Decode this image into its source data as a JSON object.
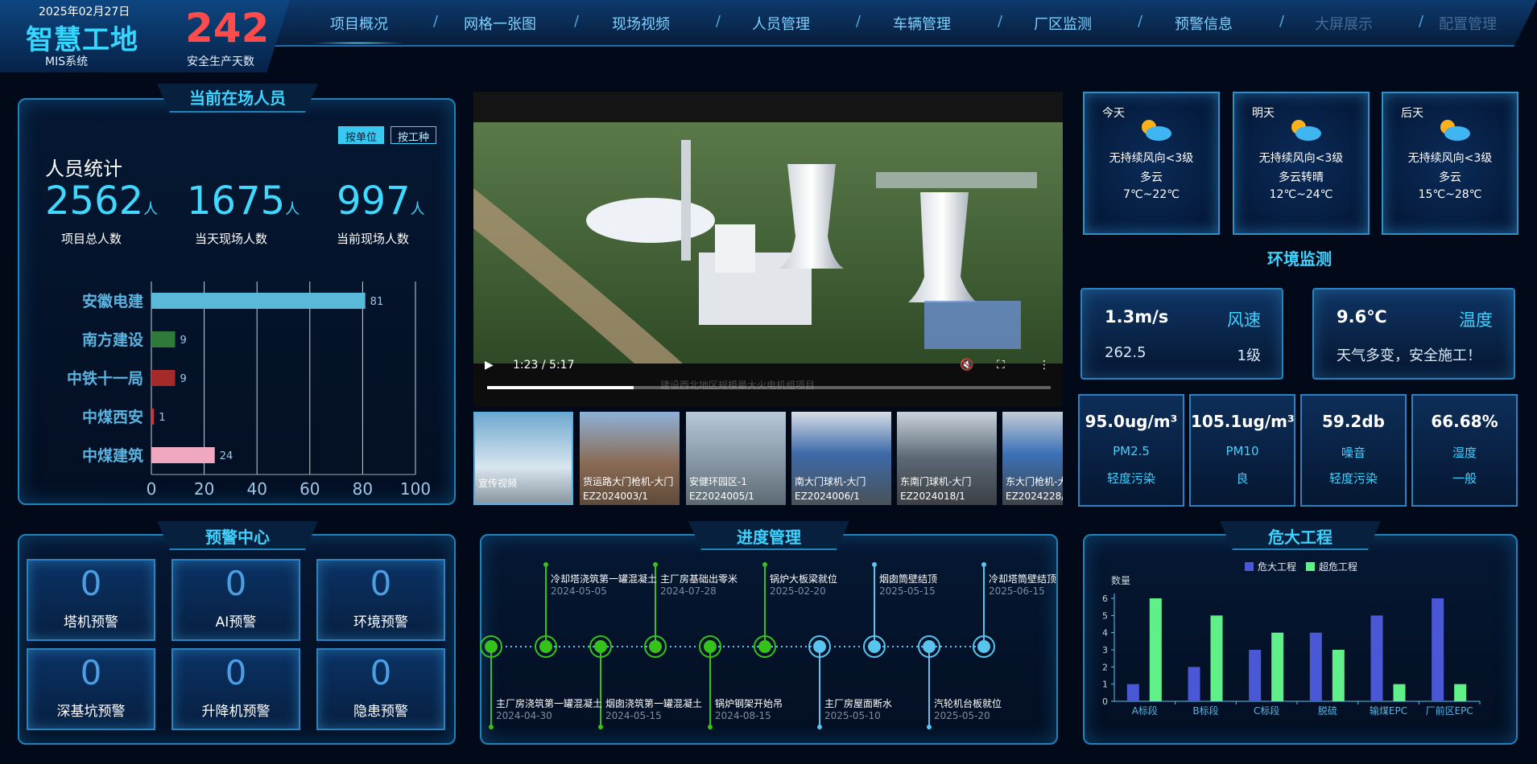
{
  "header": {
    "date": "2025年02月27日",
    "brand": "智慧工地",
    "subtitle": "MIS系统",
    "safety_days": "242",
    "safety_days_label": "安全生产天数",
    "nav": [
      {
        "label": "项目概况",
        "active": true
      },
      {
        "label": "网格一张图"
      },
      {
        "label": "现场视频"
      },
      {
        "label": "人员管理"
      },
      {
        "label": "车辆管理"
      },
      {
        "label": "厂区监测"
      },
      {
        "label": "预警信息"
      },
      {
        "label": "大屏展示",
        "dim": true
      },
      {
        "label": "配置管理",
        "dim": true
      }
    ],
    "nav_separator": "/"
  },
  "people": {
    "title": "当前在场人员",
    "toggle": [
      "按单位",
      "按工种"
    ],
    "stats_title": "人员统计",
    "unit": "人",
    "stats": [
      {
        "value": "2562",
        "label": "项目总人数"
      },
      {
        "value": "1675",
        "label": "当天现场人数"
      },
      {
        "value": "997",
        "label": "当前现场人数"
      }
    ]
  },
  "chart_data": [
    {
      "type": "bar",
      "orientation": "horizontal",
      "categories": [
        "安徽电建",
        "南方建设",
        "中铁十一局",
        "中煤西安",
        "中煤建筑"
      ],
      "values": [
        81,
        9,
        9,
        1,
        24
      ],
      "colors": [
        "#5ab8d8",
        "#2f7a3a",
        "#a52a2a",
        "#c0393b",
        "#f0a8c0"
      ],
      "xlim": [
        0,
        100
      ],
      "xticks": [
        "0",
        "20",
        "40",
        "60",
        "80",
        "100"
      ],
      "grid": true
    },
    {
      "type": "bar",
      "categories": [
        "A标段",
        "B标段",
        "C标段",
        "脱硫",
        "输煤EPC",
        "厂前区EPC"
      ],
      "series": [
        {
          "name": "危大工程",
          "values": [
            1,
            2,
            3,
            4,
            5,
            6
          ],
          "color": "#4a58d6"
        },
        {
          "name": "超危工程",
          "values": [
            6,
            5,
            4,
            3,
            1,
            1
          ],
          "color": "#5ff08a"
        }
      ],
      "ylabel": "数量",
      "ylim": [
        0,
        6
      ],
      "yticks": [
        "0",
        "1",
        "2",
        "3",
        "4",
        "5",
        "6"
      ],
      "legend": "top-center"
    }
  ],
  "video": {
    "time": "1:23 / 5:17",
    "progress": 0.26,
    "caption": "建设西北地区规模最大火电机组项目",
    "thumbs": [
      {
        "title": "宣传视频",
        "sub": ""
      },
      {
        "title": "货运路大门枪机-大门",
        "sub": "EZ2024003/1"
      },
      {
        "title": "安健环园区-1",
        "sub": "EZ2024005/1"
      },
      {
        "title": "南大门球机-大门",
        "sub": "EZ2024006/1"
      },
      {
        "title": "东南门球机-大门",
        "sub": "EZ2024018/1"
      },
      {
        "title": "东大门枪机-大",
        "sub": "EZ2024228/"
      }
    ]
  },
  "weather": [
    {
      "day": "今天",
      "wind": "无持续风向<3级",
      "cond": "多云",
      "temp": "7℃~22℃"
    },
    {
      "day": "明天",
      "wind": "无持续风向<3级",
      "cond": "多云转晴",
      "temp": "12℃~24℃"
    },
    {
      "day": "后天",
      "wind": "无持续风向<3级",
      "cond": "多云",
      "temp": "15℃~28℃"
    }
  ],
  "env": {
    "title": "环境监测",
    "wind": {
      "value": "1.3m/s",
      "name": "风速",
      "sub": "262.5",
      "level": "1级"
    },
    "temp": {
      "value": "9.6℃",
      "name": "温度",
      "sub": "天气多变，安全施工！"
    },
    "air": [
      {
        "value": "95.0ug/m³",
        "name": "PM2.5",
        "level": "轻度污染"
      },
      {
        "value": "105.1ug/m³",
        "name": "PM10",
        "level": "良"
      },
      {
        "value": "59.2db",
        "name": "噪音",
        "level": "轻度污染"
      },
      {
        "value": "66.68%",
        "name": "湿度",
        "level": "一般"
      }
    ]
  },
  "warnings": {
    "title": "预警中心",
    "items": [
      {
        "count": "0",
        "label": "塔机预警"
      },
      {
        "count": "0",
        "label": "AI预警"
      },
      {
        "count": "0",
        "label": "环境预警"
      },
      {
        "count": "0",
        "label": "深基坑预警"
      },
      {
        "count": "0",
        "label": "升降机预警"
      },
      {
        "count": "0",
        "label": "隐患预警"
      }
    ]
  },
  "progress": {
    "title": "进度管理",
    "top": [
      {
        "text": "冷却塔浇筑第一罐混凝土",
        "date": "2024-05-05"
      },
      {
        "text": "主厂房基础出零米",
        "date": "2024-07-28"
      },
      {
        "text": "锅炉大板梁就位",
        "date": "2025-02-20"
      },
      {
        "text": "烟囱筒壁结顶",
        "date": "2025-05-15"
      },
      {
        "text": "冷却塔筒壁结顶",
        "date": "2025-06-15"
      }
    ],
    "bottom": [
      {
        "text": "主厂房浇筑第一罐混凝土",
        "date": "2024-04-30"
      },
      {
        "text": "烟囱浇筑第一罐混凝土",
        "date": "2024-05-15"
      },
      {
        "text": "锅炉钢架开始吊",
        "date": "2024-08-15"
      },
      {
        "text": "主厂房屋面断水",
        "date": "2025-05-10"
      },
      {
        "text": "汽轮机台板就位",
        "date": "2025-05-20"
      }
    ]
  },
  "danger": {
    "title": "危大工程",
    "legend": [
      "危大工程",
      "超危工程"
    ]
  },
  "colors": {
    "accent": "#3ed3ff",
    "done": "#36c21a",
    "pending": "#5ac4f0"
  }
}
